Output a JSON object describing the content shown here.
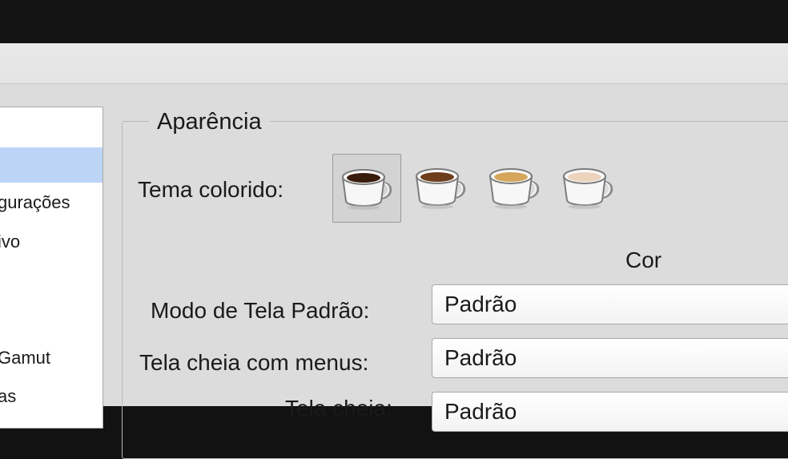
{
  "sidebar": {
    "items": [
      {
        "label": ""
      },
      {
        "label": ""
      },
      {
        "label": "gurações"
      },
      {
        "label": "ivo"
      },
      {
        "label": ""
      },
      {
        "label": ""
      },
      {
        "label": "Gamut"
      },
      {
        "label": "as"
      }
    ]
  },
  "appearance": {
    "group_title": "Aparência",
    "theme_label": "Tema colorido:",
    "themes": [
      {
        "name": "cup-icon-dark-coffee",
        "coffee_color": "#3a1c0c"
      },
      {
        "name": "cup-icon-medium-coffee",
        "coffee_color": "#6e3d1c"
      },
      {
        "name": "cup-icon-latte",
        "coffee_color": "#d4a55a"
      },
      {
        "name": "cup-icon-cream",
        "coffee_color": "#ecd4bc"
      }
    ],
    "column_header": "Cor",
    "rows": [
      {
        "label": "Modo de Tela Padrão:",
        "value": "Padrão"
      },
      {
        "label": "Tela cheia com menus:",
        "value": "Padrão"
      },
      {
        "label": "Tela cheia:",
        "value": "Padrão"
      }
    ]
  }
}
